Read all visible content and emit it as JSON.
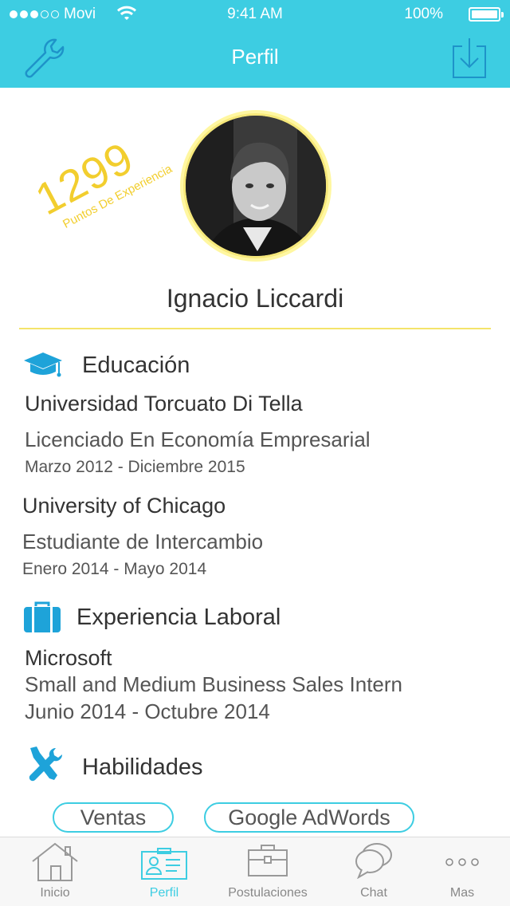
{
  "status_bar": {
    "carrier": "Movi",
    "time": "9:41 AM",
    "battery": "100%"
  },
  "nav": {
    "title": "Perfil",
    "left_icon": "wrench-icon",
    "right_icon": "download-icon"
  },
  "profile": {
    "points_value": "1299",
    "points_label": "Puntos De Experiencia",
    "name": "Ignacio Liccardi"
  },
  "education": {
    "title": "Educación",
    "icon": "graduation-cap-icon",
    "items": [
      {
        "school": "Universidad Torcuato Di Tella",
        "degree": "Licenciado En Economía Empresarial",
        "dates": "Marzo 2012 - Diciembre 2015"
      },
      {
        "school": "University of Chicago",
        "degree": "Estudiante de Intercambio",
        "dates": "Enero 2014 - Mayo 2014"
      }
    ]
  },
  "experience": {
    "title": "Experiencia Laboral",
    "icon": "briefcase-icon",
    "items": [
      {
        "company": "Microsoft",
        "role": "Small and Medium Business Sales Intern",
        "dates": "Junio 2014 - Octubre 2014"
      }
    ]
  },
  "skills": {
    "title": "Habilidades",
    "icon": "tools-icon",
    "items": [
      "Ventas",
      "Google AdWords"
    ]
  },
  "tabbar": {
    "tabs": [
      {
        "label": "Inicio",
        "icon": "home-icon",
        "active": false
      },
      {
        "label": "Perfil",
        "icon": "profile-card-icon",
        "active": true
      },
      {
        "label": "Postulaciones",
        "icon": "briefcase-icon",
        "active": false
      },
      {
        "label": "Chat",
        "icon": "chat-bubbles-icon",
        "active": false
      },
      {
        "label": "Mas",
        "icon": "more-dots-icon",
        "active": false
      }
    ]
  },
  "colors": {
    "accent": "#3dcde2",
    "gold": "#f2ce2e",
    "divider": "#f4e46a",
    "icon_blue": "#1ea3d9"
  }
}
